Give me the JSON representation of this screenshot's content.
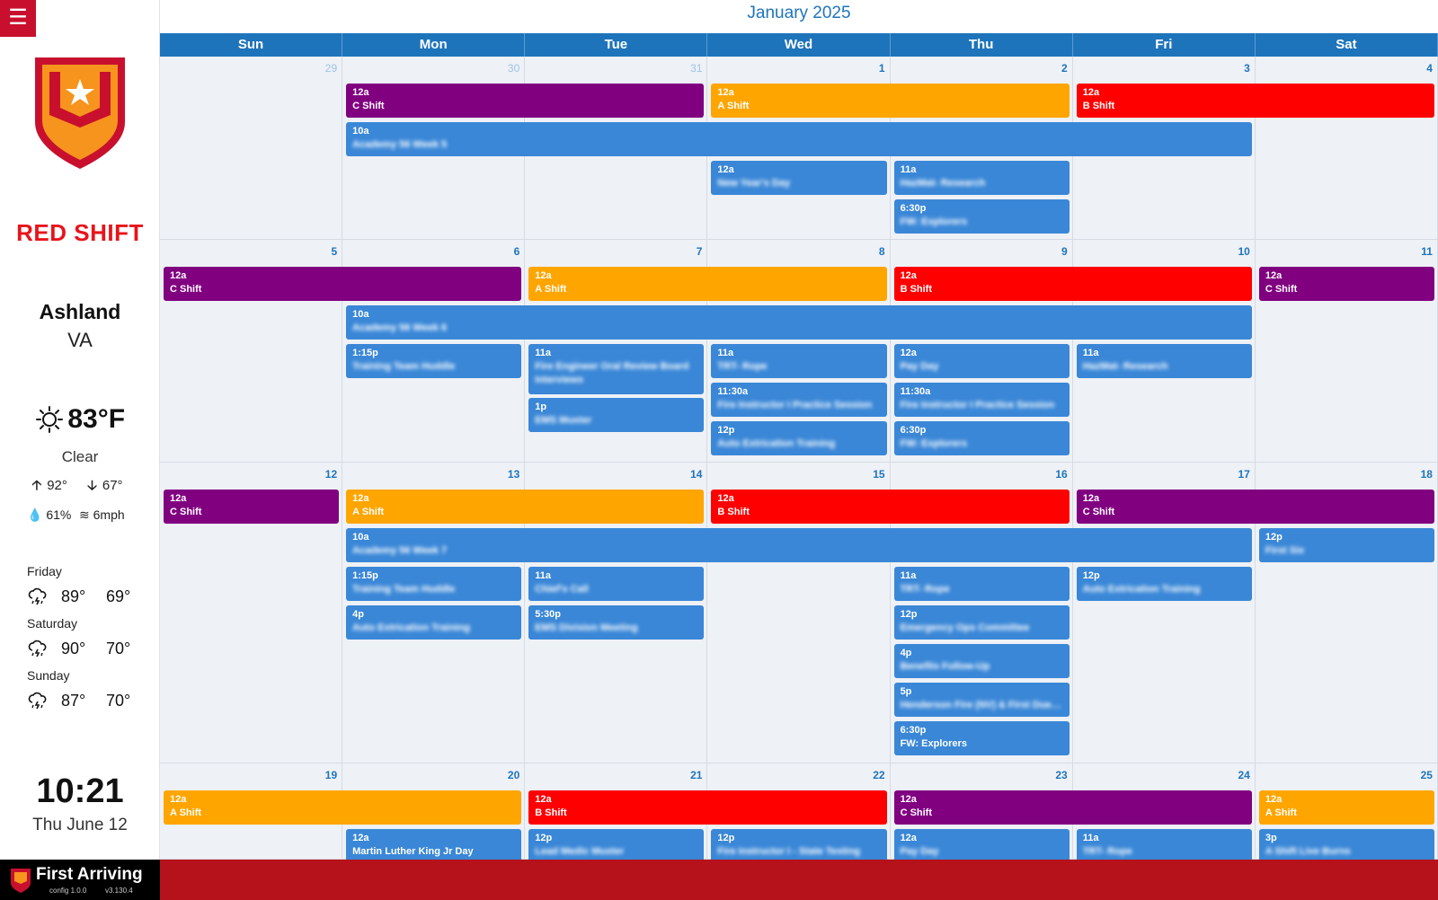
{
  "sidebar": {
    "menu_icon": "menu-icon",
    "shift_title": "RED SHIFT",
    "city": "Ashland",
    "state": "VA",
    "weather": {
      "icon": "sun-icon",
      "temp": "83°F",
      "condition": "Clear",
      "high": "92°",
      "low": "67°",
      "humidity": "61%",
      "wind": "6mph"
    },
    "forecast": [
      {
        "day": "Friday",
        "icon": "storm-icon",
        "high": "89°",
        "low": "69°"
      },
      {
        "day": "Saturday",
        "icon": "storm-icon",
        "high": "90°",
        "low": "70°"
      },
      {
        "day": "Sunday",
        "icon": "storm-icon",
        "high": "87°",
        "low": "70°"
      }
    ],
    "clock": "10:21",
    "date": "Thu June 12"
  },
  "footer": {
    "brand": "First Arriving",
    "config": "config 1.0.0",
    "version": "v3.130.4",
    "color": "#b5121b"
  },
  "colors": {
    "purple": "#800080",
    "orange": "#ffa500",
    "red": "#ff0000",
    "blue": "#3a87d7",
    "accent": "#1e74bb"
  },
  "calendar": {
    "title": "January 2025",
    "dow": [
      "Sun",
      "Mon",
      "Tue",
      "Wed",
      "Thu",
      "Fri",
      "Sat"
    ],
    "weeks": [
      [
        "29",
        "30",
        "31",
        "1",
        "2",
        "3",
        "4"
      ],
      [
        "5",
        "6",
        "7",
        "8",
        "9",
        "10",
        "11"
      ],
      [
        "12",
        "13",
        "14",
        "15",
        "16",
        "17",
        "18"
      ],
      [
        "19",
        "20",
        "21",
        "22",
        "23",
        "24",
        "25"
      ]
    ],
    "other_month": [
      [
        true,
        true,
        true,
        false,
        false,
        false,
        false
      ],
      [
        false,
        false,
        false,
        false,
        false,
        false,
        false
      ],
      [
        false,
        false,
        false,
        false,
        false,
        false,
        false
      ],
      [
        false,
        false,
        false,
        false,
        false,
        false,
        false
      ]
    ],
    "events": [
      {
        "week": 0,
        "start": 1,
        "span": 2,
        "row": 0,
        "time": "12a",
        "name": "C Shift",
        "color": "purple"
      },
      {
        "week": 0,
        "start": 3,
        "span": 2,
        "row": 0,
        "time": "12a",
        "name": "A Shift",
        "color": "orange"
      },
      {
        "week": 0,
        "start": 5,
        "span": 2,
        "row": 0,
        "time": "12a",
        "name": "B Shift",
        "color": "red"
      },
      {
        "week": 0,
        "start": 1,
        "span": 5,
        "row": 1,
        "time": "10a",
        "name": "Academy 56 Week 5",
        "color": "blue",
        "blur": true
      },
      {
        "week": 0,
        "start": 3,
        "span": 1,
        "row": 2,
        "time": "12a",
        "name": "New Year's Day",
        "color": "blue",
        "blur": true
      },
      {
        "week": 0,
        "start": 4,
        "span": 1,
        "row": 2,
        "time": "11a",
        "name": "HazMat- Research",
        "color": "blue",
        "blur": true
      },
      {
        "week": 0,
        "start": 4,
        "span": 1,
        "row": 3,
        "time": "6:30p",
        "name": "FW: Explorers",
        "color": "blue",
        "blur": true
      },
      {
        "week": 1,
        "start": 0,
        "span": 2,
        "row": 0,
        "time": "12a",
        "name": "C Shift",
        "color": "purple"
      },
      {
        "week": 1,
        "start": 2,
        "span": 2,
        "row": 0,
        "time": "12a",
        "name": "A Shift",
        "color": "orange"
      },
      {
        "week": 1,
        "start": 4,
        "span": 2,
        "row": 0,
        "time": "12a",
        "name": "B Shift",
        "color": "red"
      },
      {
        "week": 1,
        "start": 6,
        "span": 1,
        "row": 0,
        "time": "12a",
        "name": "C Shift",
        "color": "purple"
      },
      {
        "week": 1,
        "start": 1,
        "span": 5,
        "row": 1,
        "time": "10a",
        "name": "Academy 56 Week 6",
        "color": "blue",
        "blur": true
      },
      {
        "week": 1,
        "start": 1,
        "span": 1,
        "row": 2,
        "time": "1:15p",
        "name": "Training Team Huddle",
        "color": "blue",
        "blur": true
      },
      {
        "week": 1,
        "start": 2,
        "span": 1,
        "row": 2,
        "time": "11a",
        "name": "Fire Engineer Oral Review Board Interviews",
        "color": "blue",
        "blur": true,
        "tall": true
      },
      {
        "week": 1,
        "start": 2,
        "span": 1,
        "row": 3.4,
        "time": "1p",
        "name": "EMS Muster",
        "color": "blue",
        "blur": true
      },
      {
        "week": 1,
        "start": 3,
        "span": 1,
        "row": 2,
        "time": "11a",
        "name": "TRT- Rope",
        "color": "blue",
        "blur": true
      },
      {
        "week": 1,
        "start": 3,
        "span": 1,
        "row": 3,
        "time": "11:30a",
        "name": "Fire Instructor I Practice Session",
        "color": "blue",
        "blur": true
      },
      {
        "week": 1,
        "start": 3,
        "span": 1,
        "row": 4,
        "time": "12p",
        "name": "Auto Extrication Training",
        "color": "blue",
        "blur": true
      },
      {
        "week": 1,
        "start": 4,
        "span": 1,
        "row": 2,
        "time": "12a",
        "name": "Pay Day",
        "color": "blue",
        "blur": true
      },
      {
        "week": 1,
        "start": 4,
        "span": 1,
        "row": 3,
        "time": "11:30a",
        "name": "Fire Instructor I Practice Session",
        "color": "blue",
        "blur": true
      },
      {
        "week": 1,
        "start": 4,
        "span": 1,
        "row": 4,
        "time": "6:30p",
        "name": "FW: Explorers",
        "color": "blue",
        "blur": true
      },
      {
        "week": 1,
        "start": 5,
        "span": 1,
        "row": 2,
        "time": "11a",
        "name": "HazMat- Research",
        "color": "blue",
        "blur": true
      },
      {
        "week": 2,
        "start": 0,
        "span": 1,
        "row": 0,
        "time": "12a",
        "name": "C Shift",
        "color": "purple"
      },
      {
        "week": 2,
        "start": 1,
        "span": 2,
        "row": 0,
        "time": "12a",
        "name": "A Shift",
        "color": "orange"
      },
      {
        "week": 2,
        "start": 3,
        "span": 2,
        "row": 0,
        "time": "12a",
        "name": "B Shift",
        "color": "red"
      },
      {
        "week": 2,
        "start": 5,
        "span": 2,
        "row": 0,
        "time": "12a",
        "name": "C Shift",
        "color": "purple"
      },
      {
        "week": 2,
        "start": 1,
        "span": 5,
        "row": 1,
        "time": "10a",
        "name": "Academy 56 Week 7",
        "color": "blue",
        "blur": true
      },
      {
        "week": 2,
        "start": 6,
        "span": 1,
        "row": 1,
        "time": "12p",
        "name": "First Six",
        "color": "blue",
        "blur": true
      },
      {
        "week": 2,
        "start": 1,
        "span": 1,
        "row": 2,
        "time": "1:15p",
        "name": "Training Team Huddle",
        "color": "blue",
        "blur": true
      },
      {
        "week": 2,
        "start": 1,
        "span": 1,
        "row": 3,
        "time": "4p",
        "name": "Auto Extrication Training",
        "color": "blue",
        "blur": true
      },
      {
        "week": 2,
        "start": 2,
        "span": 1,
        "row": 2,
        "time": "11a",
        "name": "Chief's Call",
        "color": "blue",
        "blur": true
      },
      {
        "week": 2,
        "start": 2,
        "span": 1,
        "row": 3,
        "time": "5:30p",
        "name": "EMS Division Meeting",
        "color": "blue",
        "blur": true
      },
      {
        "week": 2,
        "start": 4,
        "span": 1,
        "row": 2,
        "time": "11a",
        "name": "TRT- Rope",
        "color": "blue",
        "blur": true
      },
      {
        "week": 2,
        "start": 4,
        "span": 1,
        "row": 3,
        "time": "12p",
        "name": "Emergency Ops Committee",
        "color": "blue",
        "blur": true
      },
      {
        "week": 2,
        "start": 4,
        "span": 1,
        "row": 4,
        "time": "4p",
        "name": "Benefits Follow-Up",
        "color": "blue",
        "blur": true
      },
      {
        "week": 2,
        "start": 4,
        "span": 1,
        "row": 5,
        "time": "5p",
        "name": "Henderson Fire (NV) & First Due Demo",
        "color": "blue",
        "blur": true
      },
      {
        "week": 2,
        "start": 4,
        "span": 1,
        "row": 6,
        "time": "6:30p",
        "name": "FW: Explorers",
        "color": "blue"
      },
      {
        "week": 2,
        "start": 5,
        "span": 1,
        "row": 2,
        "time": "12p",
        "name": "Auto Extrication Training",
        "color": "blue",
        "blur": true
      },
      {
        "week": 3,
        "start": 0,
        "span": 2,
        "row": 0,
        "time": "12a",
        "name": "A Shift",
        "color": "orange"
      },
      {
        "week": 3,
        "start": 2,
        "span": 2,
        "row": 0,
        "time": "12a",
        "name": "B Shift",
        "color": "red"
      },
      {
        "week": 3,
        "start": 4,
        "span": 2,
        "row": 0,
        "time": "12a",
        "name": "C Shift",
        "color": "purple"
      },
      {
        "week": 3,
        "start": 6,
        "span": 1,
        "row": 0,
        "time": "12a",
        "name": "A Shift",
        "color": "orange"
      },
      {
        "week": 3,
        "start": 1,
        "span": 1,
        "row": 1,
        "time": "12a",
        "name": "Martin Luther King Jr Day",
        "color": "blue"
      },
      {
        "week": 3,
        "start": 2,
        "span": 1,
        "row": 1,
        "time": "12p",
        "name": "Lead Medic Muster",
        "color": "blue",
        "blur": true
      },
      {
        "week": 3,
        "start": 3,
        "span": 1,
        "row": 1,
        "time": "12p",
        "name": "Fire Instructor I - State Testing",
        "color": "blue",
        "blur": true
      },
      {
        "week": 3,
        "start": 4,
        "span": 1,
        "row": 1,
        "time": "12a",
        "name": "Pay Day",
        "color": "blue",
        "blur": true
      },
      {
        "week": 3,
        "start": 5,
        "span": 1,
        "row": 1,
        "time": "11a",
        "name": "TRT- Rope",
        "color": "blue",
        "blur": true
      },
      {
        "week": 3,
        "start": 6,
        "span": 1,
        "row": 1,
        "time": "3p",
        "name": "A Shift Live Burns",
        "color": "blue",
        "blur": true
      }
    ]
  }
}
